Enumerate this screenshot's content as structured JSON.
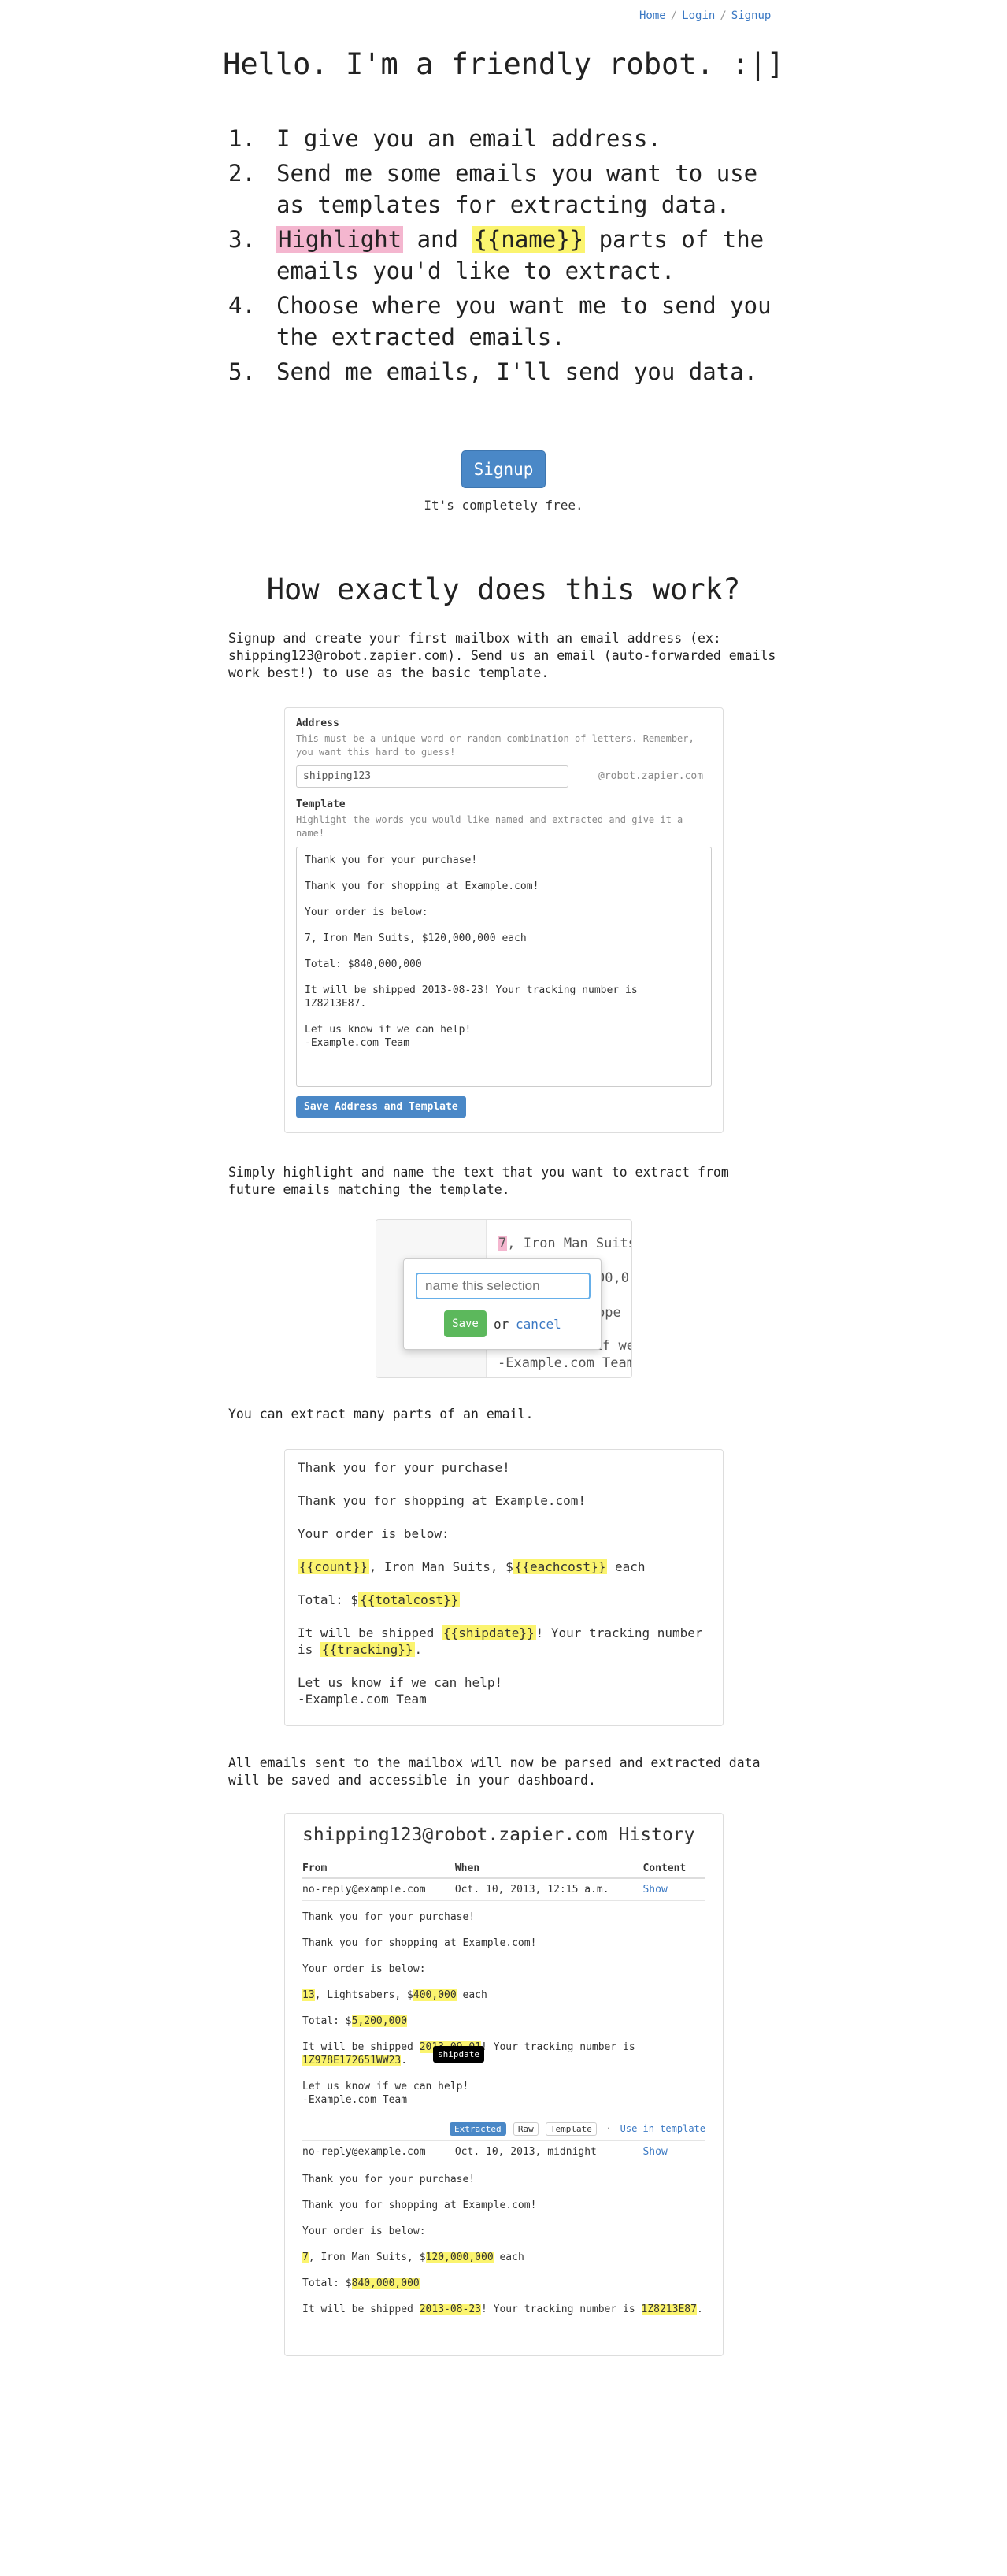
{
  "nav": {
    "home": "Home",
    "login": "Login",
    "signup": "Signup",
    "sep": "/"
  },
  "hero": {
    "title": "Hello. I'm a friendly robot. :|]",
    "steps": [
      {
        "num": "1.",
        "text": "I give you an email address."
      },
      {
        "num": "2.",
        "text": "Send me some emails you want to use as templates for extracting data."
      },
      {
        "num": "3.",
        "hl_pink": "Highlight",
        "mid": " and ",
        "hl_yellow": "{{name}}",
        "rest": " parts of the emails you'd like to extract."
      },
      {
        "num": "4.",
        "text": "Choose where you want me to send you the extracted emails."
      },
      {
        "num": "5.",
        "text": "Send me emails, I'll send you data."
      }
    ],
    "signup_button": "Signup",
    "free_text": "It's completely free."
  },
  "how": {
    "title": "How exactly does this work?",
    "intro": "Signup and create your first mailbox with an email address (ex: shipping123@robot.zapier.com). Send us an email (auto-forwarded emails work best!) to use as the basic template.",
    "highlight_text": "Simply highlight and name the text that you want to extract from future emails matching the template.",
    "many_text": "You can extract many parts of an email.",
    "saved_text": "All emails sent to the mailbox will now be parsed and extracted data will be saved and accessible in your dashboard."
  },
  "form": {
    "address_label": "Address",
    "address_help": "This must be a unique word or random combination of letters. Remember, you want this hard to guess!",
    "address_value": "shipping123",
    "address_suffix": "@robot.zapier.com",
    "template_label": "Template",
    "template_help": "Highlight the words you would like named and extracted and give it a name!",
    "template_lines": [
      "Thank you for your purchase!",
      "Thank you for shopping at Example.com!",
      "Your order is below:",
      "7, Iron Man Suits, $120,000,000 each",
      "Total: $840,000,000",
      "It will be shipped 2013-08-23! Your tracking number is 1Z8213E87.",
      "Let us know if we can help!",
      "-Example.com Team"
    ],
    "save_button": "Save Address and Template"
  },
  "demo": {
    "line1_hl": "7",
    "line1_rest": ", Iron Man Suits",
    "line2": "00,0",
    "line3": "ppe",
    "line4": "Let us know if we",
    "line5": "-Example.com Team",
    "popup_placeholder": "name this selection",
    "popup_save": "Save",
    "popup_or": "or",
    "popup_cancel": "cancel"
  },
  "ext": {
    "l1": "Thank you for your purchase!",
    "l2": "Thank you for shopping at Example.com!",
    "l3": "Your order is below:",
    "count": "{{count}}",
    "l4_mid": ", Iron Man Suits, $",
    "eachcost": "{{eachcost}}",
    "l4_end": " each",
    "l5_pre": "Total: $",
    "totalcost": "{{totalcost}}",
    "l6_pre": "It will be shipped ",
    "shipdate": "{{shipdate}}",
    "l6_mid": "! Your tracking number is ",
    "tracking": "{{tracking}}",
    "l6_end": ".",
    "l7": "Let us know if we can help!",
    "l8": "-Example.com Team"
  },
  "history": {
    "title": "shipping123@robot.zapier.com History",
    "headers": {
      "from": "From",
      "when": "When",
      "content": "Content"
    },
    "rows": [
      {
        "from": "no-reply@example.com",
        "when": "Oct. 10, 2013, 12:15 a.m.",
        "content": "Show",
        "l1": "Thank you for your purchase!",
        "l2": "Thank you for shopping at Example.com!",
        "l3": "Your order is below:",
        "count": "13",
        "l4_mid": ", Lightsabers, $",
        "eachcost": "400,000",
        "l4_end": " each",
        "l5_pre": "Total: $",
        "totalcost": "5,200,000",
        "tooltip": "shipdate",
        "l6_pre": "It will be shipped ",
        "shipdate": "2013-09-01",
        "l6_mid": "! Your tracking number is ",
        "tracking": "1Z978E172651WW23",
        "l6_end": ".",
        "l7": "Let us know if we can help!",
        "l8": "-Example.com Team",
        "tabs": {
          "extracted": "Extracted",
          "raw": "Raw",
          "template": "Template",
          "dot": "·",
          "use": "Use in template"
        }
      },
      {
        "from": "no-reply@example.com",
        "when": "Oct. 10, 2013, midnight",
        "content": "Show",
        "l1": "Thank you for your purchase!",
        "l2": "Thank you for shopping at Example.com!",
        "l3": "Your order is below:",
        "count": "7",
        "l4_mid": ", Iron Man Suits, $",
        "eachcost": "120,000,000",
        "l4_end": " each",
        "l5_pre": "Total: $",
        "totalcost": "840,000,000",
        "l6_pre": "It will be shipped ",
        "shipdate": "2013-08-23",
        "l6_mid": "! Your tracking number is ",
        "tracking": "1Z8213E87",
        "l6_end": "."
      }
    ]
  },
  "colors": {
    "accent": "#4a88c7",
    "highlight_yellow": "#fbf46f",
    "highlight_pink": "#f4b6cf",
    "success": "#5cb85c"
  }
}
